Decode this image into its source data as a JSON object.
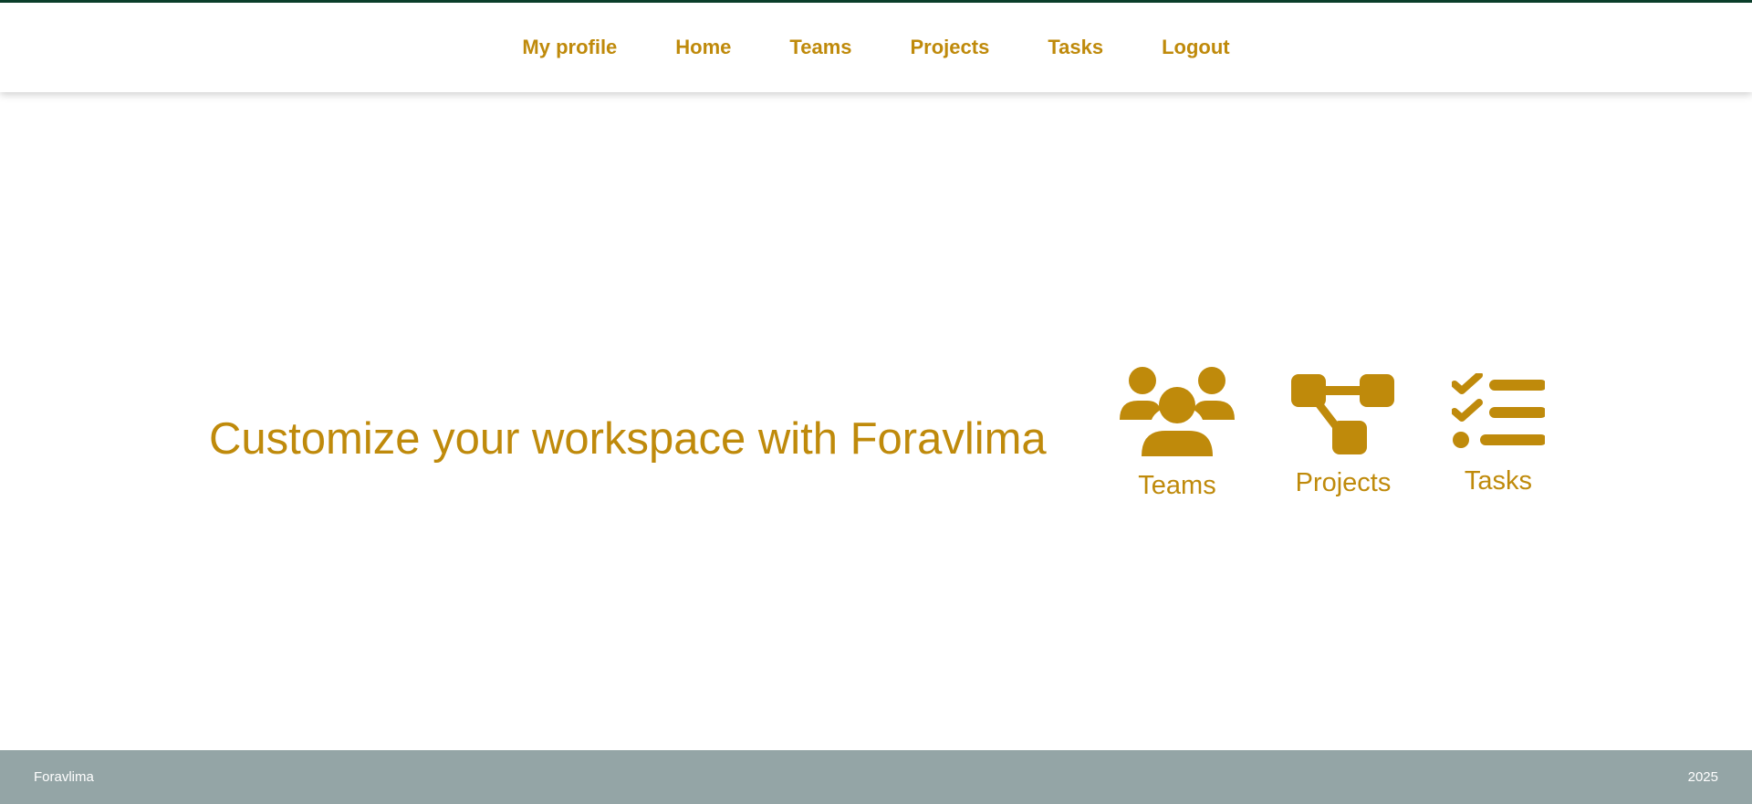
{
  "nav": {
    "items": [
      {
        "label": "My profile"
      },
      {
        "label": "Home"
      },
      {
        "label": "Teams"
      },
      {
        "label": "Projects"
      },
      {
        "label": "Tasks"
      },
      {
        "label": "Logout"
      }
    ]
  },
  "hero": {
    "headline": "Customize your workspace with Foravlima",
    "features": [
      {
        "label": "Teams",
        "icon": "users-icon"
      },
      {
        "label": "Projects",
        "icon": "diagram-project-icon"
      },
      {
        "label": "Tasks",
        "icon": "list-check-icon"
      }
    ]
  },
  "footer": {
    "brand": "Foravlima",
    "year": "2025"
  },
  "colors": {
    "accent": "#bf8a0b",
    "top_border": "#0a3d2a",
    "footer_bg": "#94a5a6"
  }
}
